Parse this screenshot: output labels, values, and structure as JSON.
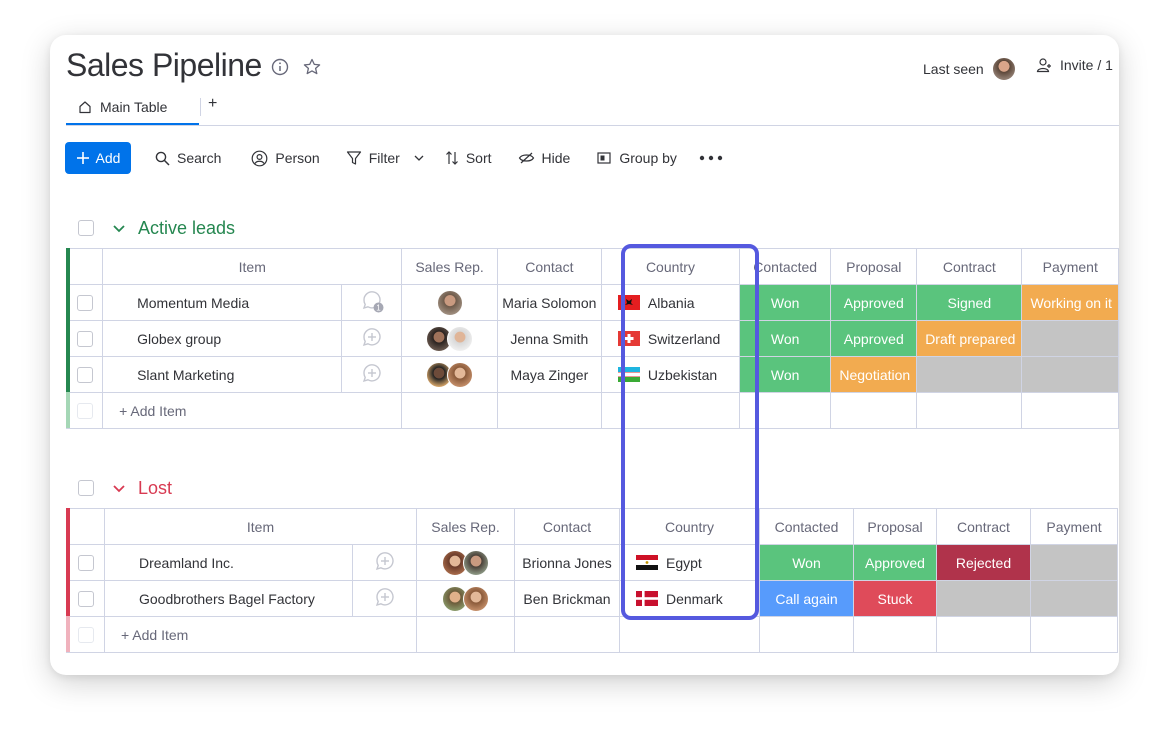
{
  "board": {
    "title": "Sales Pipeline",
    "last_seen_label": "Last seen",
    "invite_label": "Invite / 1"
  },
  "tabs": {
    "main": "Main Table",
    "add": "+"
  },
  "toolbar": {
    "add": "Add",
    "search": "Search",
    "person": "Person",
    "filter": "Filter",
    "sort": "Sort",
    "hide": "Hide",
    "group_by": "Group by"
  },
  "columns": [
    "Item",
    "Sales Rep.",
    "Contact",
    "Country",
    "Contacted",
    "Proposal",
    "Contract",
    "Payment"
  ],
  "colors": {
    "won": "#5ac47d",
    "approved": "#5ac47d",
    "signed": "#5ac47d",
    "working": "#f2ab50",
    "draft": "#f2ab50",
    "negotiation": "#f2ab50",
    "rejected": "#b0334b",
    "call_again": "#579bfc",
    "stuck": "#df4b5a",
    "empty": "#c4c4c4",
    "active_group": "#258750",
    "lost_group": "#d83a52",
    "highlight": "#5559df"
  },
  "groups": [
    {
      "title": "Active leads",
      "add_item": "+ Add Item",
      "rows": [
        {
          "name": "Momentum Media",
          "contact": "Maria Solomon",
          "country": "Albania",
          "contacted": "Won",
          "proposal": "Approved",
          "contract": "Signed",
          "payment": "Working on it",
          "update_count": "1"
        },
        {
          "name": "Globex group",
          "contact": "Jenna Smith",
          "country": "Switzerland",
          "contacted": "Won",
          "proposal": "Approved",
          "contract": "Draft prepared",
          "payment": ""
        },
        {
          "name": "Slant Marketing",
          "contact": "Maya Zinger",
          "country": "Uzbekistan",
          "contacted": "Won",
          "proposal": "Negotiation",
          "contract": "",
          "payment": ""
        }
      ]
    },
    {
      "title": "Lost",
      "add_item": "+ Add Item",
      "rows": [
        {
          "name": "Dreamland Inc.",
          "contact": "Brionna Jones",
          "country": "Egypt",
          "contacted": "Won",
          "proposal": "Approved",
          "contract": "Rejected",
          "payment": ""
        },
        {
          "name": "Goodbrothers Bagel Factory",
          "contact": "Ben Brickman",
          "country": "Denmark",
          "contacted": "Call again",
          "proposal": "Stuck",
          "contract": "",
          "payment": ""
        }
      ]
    }
  ]
}
